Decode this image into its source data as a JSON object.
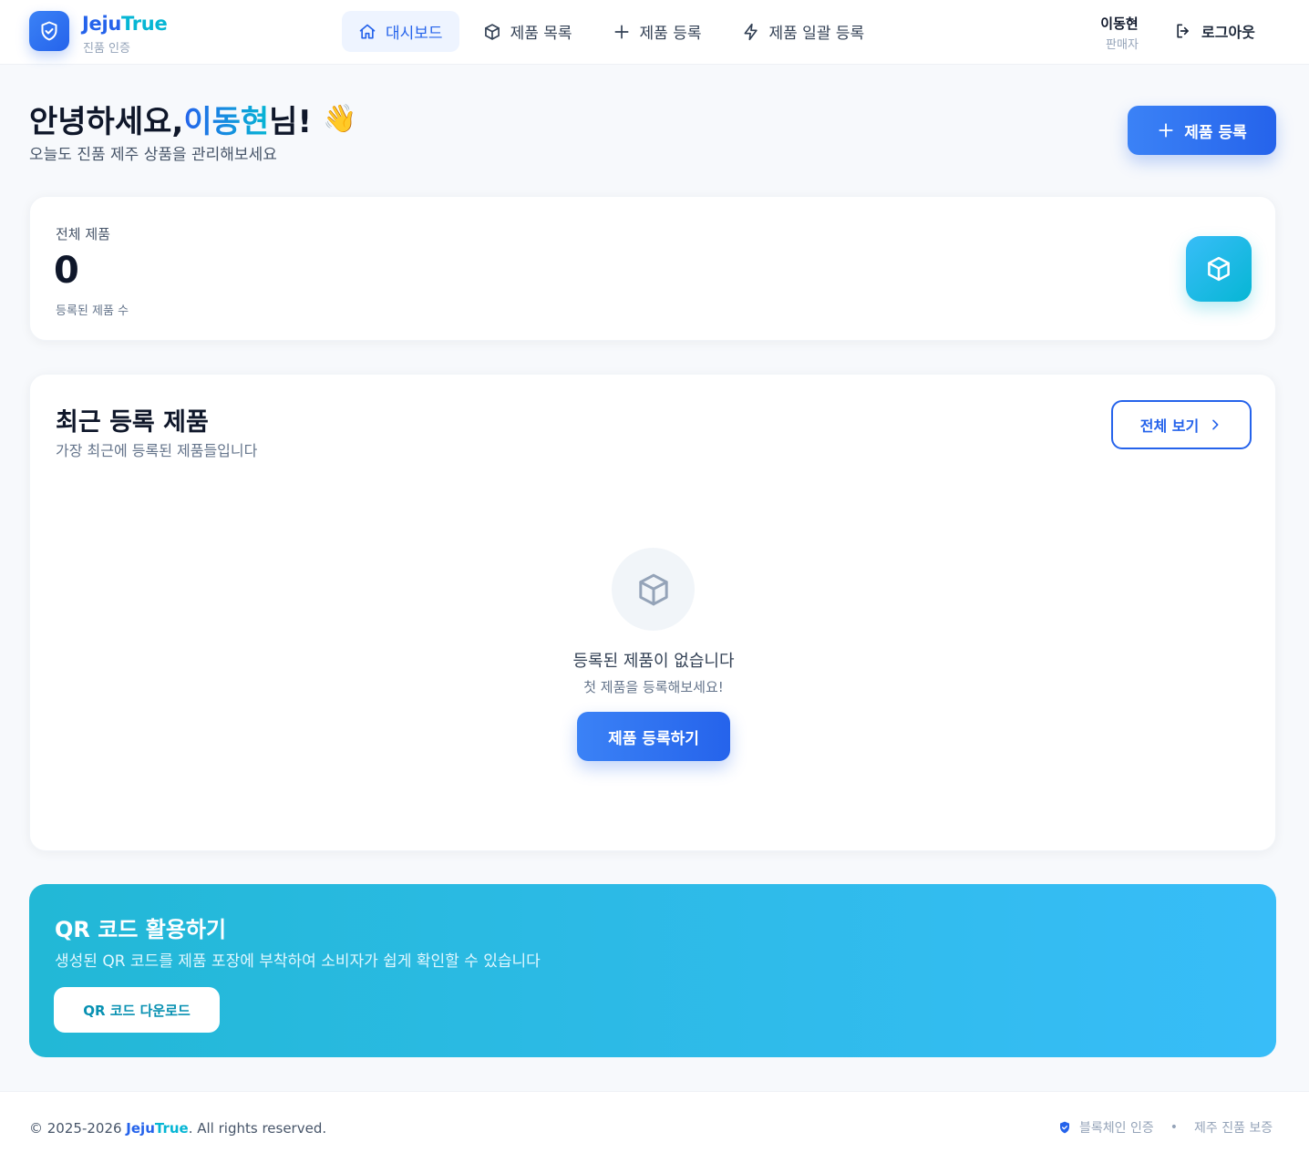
{
  "brand": {
    "name_part1": "Jeju",
    "name_part2": "True",
    "subtitle": "진품 인증"
  },
  "nav": [
    {
      "label": "대시보드",
      "icon": "home-icon",
      "active": true
    },
    {
      "label": "제품 목록",
      "icon": "box-icon",
      "active": false
    },
    {
      "label": "제품 등록",
      "icon": "plus-icon",
      "active": false
    },
    {
      "label": "제품 일괄 등록",
      "icon": "lightning-icon",
      "active": false
    }
  ],
  "user": {
    "name": "이동현",
    "role": "판매자"
  },
  "logout_label": "로그아웃",
  "greeting": {
    "prefix": "안녕하세요, ",
    "name": "이동현",
    "suffix": "님!",
    "emoji": "👋",
    "subtitle": "오늘도 진품 제주 상품을 관리해보세요"
  },
  "primary_action": {
    "label": "제품 등록"
  },
  "stats": {
    "label": "전체 제품",
    "value": "0",
    "sublabel": "등록된 제품 수"
  },
  "recent": {
    "title": "최근 등록 제품",
    "subtitle": "가장 최근에 등록된 제품들입니다",
    "view_all_label": "전체 보기",
    "empty_title": "등록된 제품이 없습니다",
    "empty_subtitle": "첫 제품을 등록해보세요!",
    "empty_button": "제품 등록하기"
  },
  "qr": {
    "title": "QR 코드 활용하기",
    "subtitle": "생성된 QR 코드를 제품 포장에 부착하여 소비자가 쉽게 확인할 수 있습니다",
    "button": "QR 코드 다운로드"
  },
  "footer": {
    "copyright_prefix": "© 2025-2026 ",
    "brand_part1": "Jeju",
    "brand_part2": "True",
    "copyright_suffix": ". All rights reserved.",
    "badge_blockchain": "블록체인 인증",
    "separator": "•",
    "badge_guarantee": "제주 진품 보증"
  },
  "colors": {
    "primary": "#2563eb",
    "accent": "#06b6d4",
    "background": "#f7f9fc"
  }
}
